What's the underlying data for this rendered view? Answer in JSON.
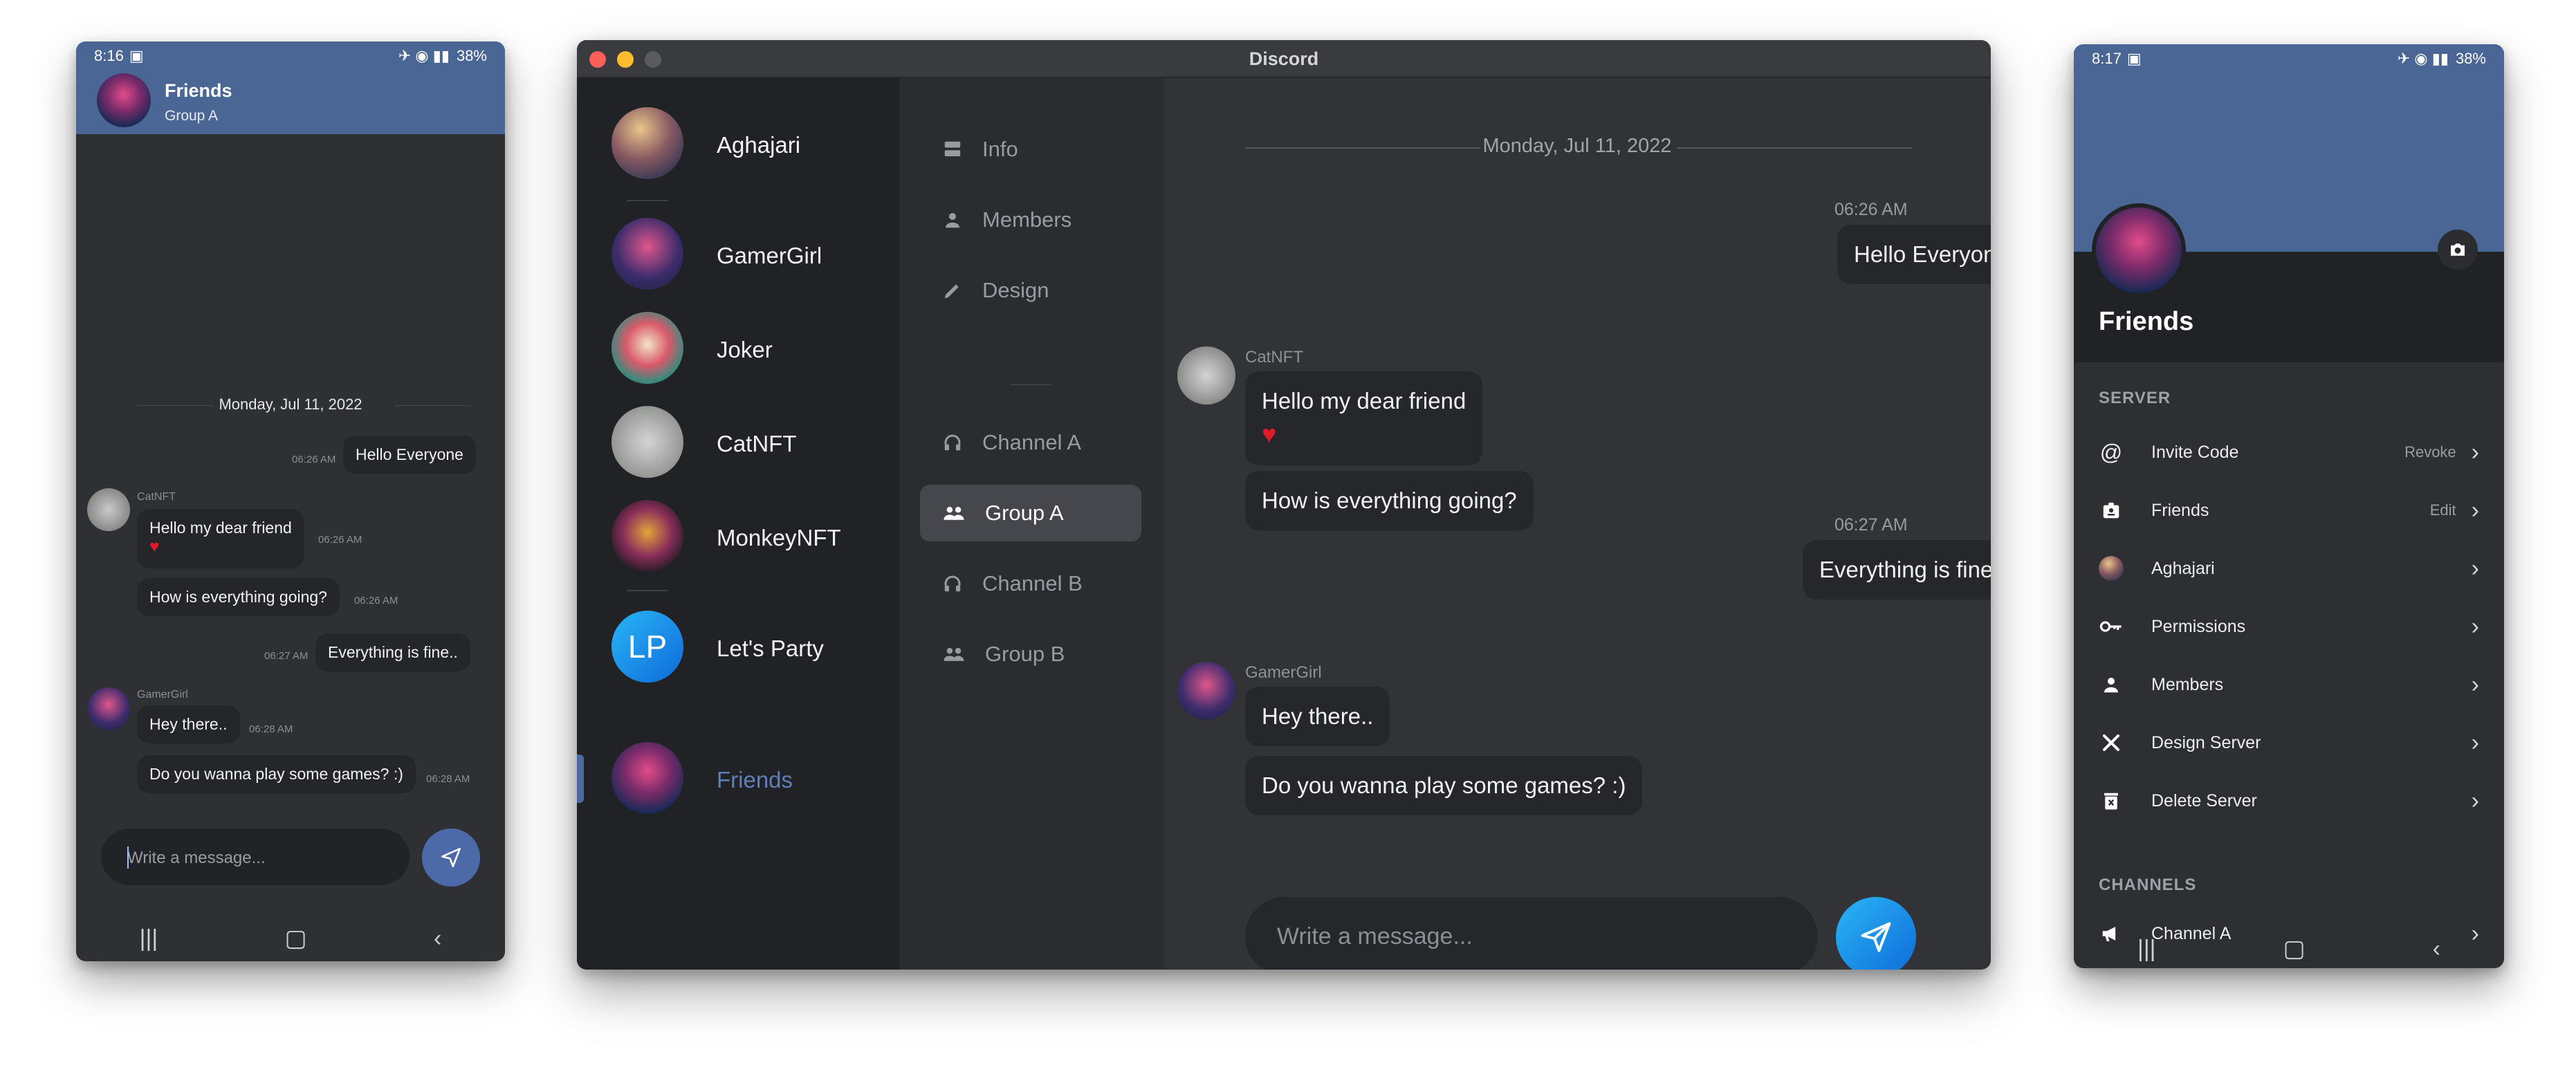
{
  "left_phone": {
    "status": {
      "time": "8:16",
      "right": "38%"
    },
    "header": {
      "title": "Friends",
      "subtitle": "Group A"
    },
    "date": "Monday, Jul 11, 2022",
    "messages": [
      {
        "text": "Hello Everyone",
        "time": "06:26 AM"
      },
      {
        "author": "CatNFT",
        "text": "Hello my dear friend",
        "emoji": "♥",
        "time": "06:26 AM"
      },
      {
        "text": "How is everything going?",
        "time": "06:26 AM"
      },
      {
        "text": "Everything is fine..",
        "time": "06:27 AM"
      },
      {
        "author": "GamerGirl",
        "text": "Hey there..",
        "time": "06:28 AM"
      },
      {
        "text": "Do you wanna play some games? :)",
        "time": "06:28 AM"
      }
    ],
    "input_placeholder": "Write a message...",
    "nav": [
      "|||",
      "▢",
      "‹"
    ]
  },
  "desktop": {
    "window_title": "Discord",
    "servers": [
      {
        "name": "Aghajari"
      },
      {
        "name": "GamerGirl"
      },
      {
        "name": "Joker"
      },
      {
        "name": "CatNFT"
      },
      {
        "name": "MonkeyNFT"
      },
      {
        "name": "Let's Party",
        "initials": "LP"
      },
      {
        "name": "Friends",
        "selected": true
      }
    ],
    "menu": [
      {
        "label": "Info",
        "icon": "storage-icon"
      },
      {
        "label": "Members",
        "icon": "person-icon"
      },
      {
        "label": "Design",
        "icon": "pencil-icon"
      }
    ],
    "channels": [
      {
        "label": "Channel A",
        "icon": "headphones-icon"
      },
      {
        "label": "Group A",
        "icon": "group-icon",
        "active": true
      },
      {
        "label": "Channel B",
        "icon": "headphones-icon"
      },
      {
        "label": "Group B",
        "icon": "group-icon"
      }
    ],
    "date": "Monday, Jul 11, 2022",
    "messages": [
      {
        "time": "06:26 AM",
        "text": "Hello Everyone"
      },
      {
        "author": "CatNFT",
        "text": "Hello my dear friend",
        "emoji": "♥"
      },
      {
        "text": "How is everything going?"
      },
      {
        "time": "06:27 AM",
        "text": "Everything is fine.."
      },
      {
        "author": "GamerGirl",
        "text": "Hey there.."
      },
      {
        "text": "Do you wanna play some games? :)"
      }
    ],
    "input_placeholder": "Write a message..."
  },
  "right_phone": {
    "status": {
      "time": "8:17",
      "right": "38%"
    },
    "title": "Friends",
    "server_section": "SERVER",
    "server_rows": [
      {
        "label": "Invite Code",
        "action": "Revoke",
        "icon": "at-icon"
      },
      {
        "label": "Friends",
        "action": "Edit",
        "icon": "badge-icon"
      },
      {
        "label": "Aghajari",
        "icon": "avatar-icon"
      },
      {
        "label": "Permissions",
        "icon": "key-icon"
      },
      {
        "label": "Members",
        "icon": "person-icon"
      },
      {
        "label": "Design Server",
        "icon": "tools-icon"
      },
      {
        "label": "Delete Server",
        "icon": "trash-icon"
      }
    ],
    "channels_section": "CHANNELS",
    "channel_rows": [
      {
        "label": "Channel A",
        "icon": "megaphone-icon"
      }
    ],
    "nav": [
      "|||",
      "▢",
      "‹"
    ]
  }
}
